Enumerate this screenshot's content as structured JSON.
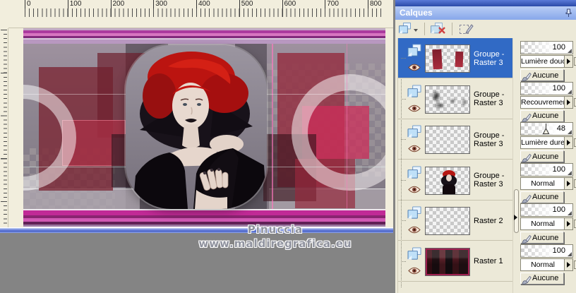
{
  "palette": {
    "title": "Calques",
    "toolbar": [
      {
        "name": "new-layer-button"
      },
      {
        "name": "delete-layer-button"
      },
      {
        "name": "edit-selection-button"
      }
    ]
  },
  "ruler": {
    "h_labels": [
      "0",
      "100",
      "200",
      "300",
      "400",
      "500",
      "600",
      "700",
      "800"
    ]
  },
  "layers": [
    {
      "name": "Groupe - Raster 3",
      "opacity": "100",
      "blend_mode": "Lumière douce",
      "link": "Aucune",
      "selected": true,
      "thumb": "red-bars"
    },
    {
      "name": "Groupe - Raster 3",
      "opacity": "100",
      "blend_mode": "Recouvrement",
      "link": "Aucune",
      "selected": false,
      "thumb": "black-smudges"
    },
    {
      "name": "Groupe - Raster 3",
      "opacity": "48",
      "blend_mode": "Lumière dure",
      "link": "Aucune",
      "selected": false,
      "thumb": "empty"
    },
    {
      "name": "Groupe - Raster 3",
      "opacity": "100",
      "blend_mode": "Normal",
      "link": "Aucune",
      "selected": false,
      "thumb": "portrait"
    },
    {
      "name": "Raster 2",
      "opacity": "100",
      "blend_mode": "Normal",
      "link": "Aucune",
      "selected": false,
      "thumb": "empty"
    },
    {
      "name": "Raster 1",
      "opacity": "100",
      "blend_mode": "Normal",
      "link": "Aucune",
      "selected": false,
      "thumb": "dark-abstract"
    }
  ],
  "watermark": {
    "line1": "Pinuccia",
    "line2": "www.maldiregrafica.eu"
  },
  "colors": {
    "selection_blue": "#316ac5",
    "panel_bg": "#ece9d8",
    "titlebar_blue": "#87a7ea",
    "workspace_gray": "#848484",
    "canvas_magenta": "#c12a96",
    "canvas_dark_red": "#7c2836",
    "window_border_blue": "#4a63c8"
  }
}
